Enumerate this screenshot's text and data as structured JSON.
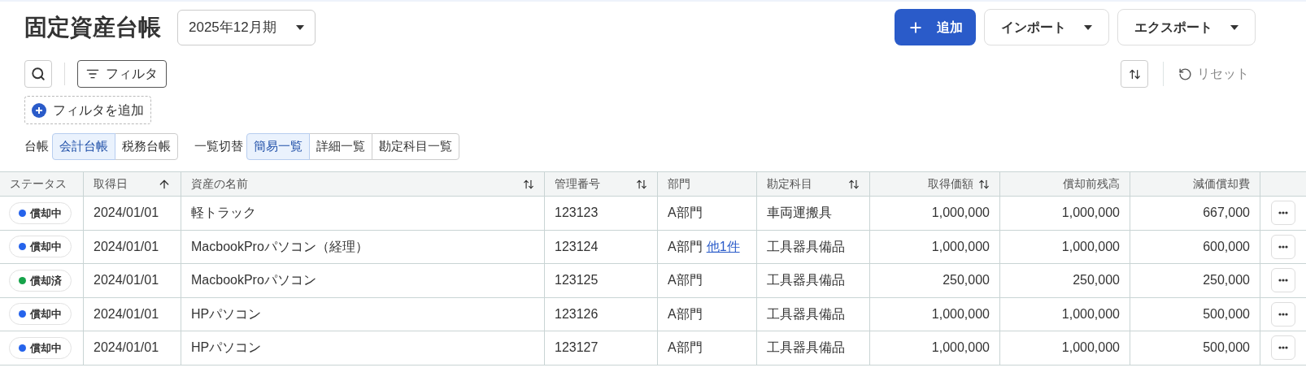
{
  "title": "固定資産台帳",
  "period": {
    "value": "2025年12月期"
  },
  "header_buttons": [
    {
      "kind": "primary",
      "label": "追加"
    },
    {
      "kind": "menu",
      "label": "インポート"
    },
    {
      "kind": "menu",
      "label": "エクスポート"
    }
  ],
  "toolbar": {
    "filter_label": "フィルタ",
    "add_filter_label": "フィルタを追加",
    "reset_label": "リセット"
  },
  "ledger": {
    "label": "台帳",
    "options": [
      {
        "label": "会計台帳",
        "selected": true
      },
      {
        "label": "税務台帳",
        "selected": false
      }
    ]
  },
  "view": {
    "label": "一覧切替",
    "options": [
      {
        "label": "簡易一覧",
        "selected": true
      },
      {
        "label": "詳細一覧",
        "selected": false
      },
      {
        "label": "勘定科目一覧",
        "selected": false
      }
    ]
  },
  "table": {
    "columns": [
      {
        "label": "ステータス",
        "kind": "text",
        "sortable": false,
        "sorted": false
      },
      {
        "label": "取得日",
        "kind": "text",
        "sortable": true,
        "sorted": true
      },
      {
        "label": "資産の名前",
        "kind": "text",
        "sortable": true,
        "sorted": false
      },
      {
        "label": "管理番号",
        "kind": "text",
        "sortable": true,
        "sorted": false
      },
      {
        "label": "部門",
        "kind": "text",
        "sortable": false,
        "sorted": false
      },
      {
        "label": "勘定科目",
        "kind": "text",
        "sortable": true,
        "sorted": false
      },
      {
        "label": "取得価額",
        "kind": "amount",
        "sortable": true,
        "sorted": false
      },
      {
        "label": "償却前残高",
        "kind": "amount",
        "sortable": false,
        "sorted": false
      },
      {
        "label": "減価償却費",
        "kind": "amount",
        "sortable": false,
        "sorted": false
      }
    ],
    "rows": [
      {
        "status": {
          "label": "償却中",
          "color": "#2563eb"
        },
        "date": "2024/01/01",
        "name": "軽トラック",
        "code": "123123",
        "dept": "A部門",
        "account": "車両運搬具",
        "acquisition": "1,000,000",
        "balance": "1,000,000",
        "depreciation": "667,000"
      },
      {
        "status": {
          "label": "償却中",
          "color": "#2563eb"
        },
        "date": "2024/01/01",
        "name": "MacbookProパソコン（経理）",
        "code": "123124",
        "dept": "A部門",
        "dept_more": "他1件",
        "account": "工具器具備品",
        "acquisition": "1,000,000",
        "balance": "1,000,000",
        "depreciation": "600,000"
      },
      {
        "status": {
          "label": "償却済",
          "color": "#16a34a"
        },
        "date": "2024/01/01",
        "name": "MacbookProパソコン",
        "code": "123125",
        "dept": "A部門",
        "account": "工具器具備品",
        "acquisition": "250,000",
        "balance": "250,000",
        "depreciation": "250,000"
      },
      {
        "status": {
          "label": "償却中",
          "color": "#2563eb"
        },
        "date": "2024/01/01",
        "name": "HPパソコン",
        "code": "123126",
        "dept": "A部門",
        "account": "工具器具備品",
        "acquisition": "1,000,000",
        "balance": "1,000,000",
        "depreciation": "500,000"
      },
      {
        "status": {
          "label": "償却中",
          "color": "#2563eb"
        },
        "date": "2024/01/01",
        "name": "HPパソコン",
        "code": "123127",
        "dept": "A部門",
        "account": "工具器具備品",
        "acquisition": "1,000,000",
        "balance": "1,000,000",
        "depreciation": "500,000"
      }
    ]
  }
}
